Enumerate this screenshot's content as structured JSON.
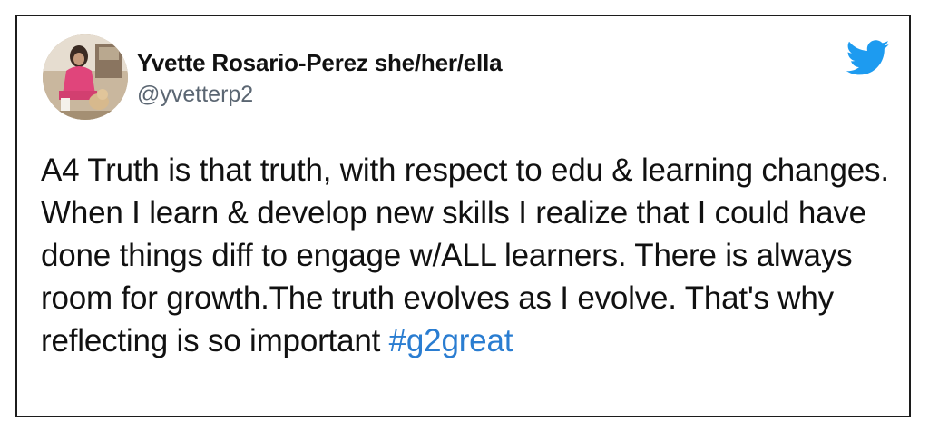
{
  "tweet": {
    "author_name": "Yvette Rosario-Perez she/her/ella",
    "handle": "@yvetterp2",
    "text_before_hashtag": "A4 Truth is that truth, with respect to edu & learning changes. When I learn & develop new skills I realize that I could have done things diff to engage w/ALL learners. There is always room for growth.The truth evolves as I evolve. That's why reflecting is so important ",
    "hashtag": "#g2great"
  },
  "icons": {
    "logo": "twitter-bird-icon",
    "avatar": "profile-photo"
  },
  "colors": {
    "brand_blue": "#1d9bf0",
    "hashtag_blue": "#2a7dd1",
    "text": "#111111",
    "handle_gray": "#5b6672",
    "border": "#1c1c1c"
  }
}
